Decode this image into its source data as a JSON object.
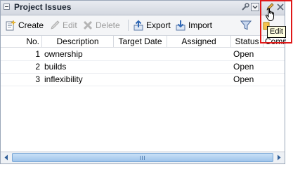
{
  "panel": {
    "title": "Project Issues"
  },
  "toolbar": {
    "create": "Create",
    "edit": "Edit",
    "delete": "Delete",
    "export": "Export",
    "import": "Import"
  },
  "table": {
    "columns": [
      "No.",
      "Description",
      "Target Date",
      "Assigned",
      "Status",
      "Comm"
    ],
    "rows": [
      {
        "no": "1",
        "description": "ownership",
        "target_date": "",
        "assigned": "",
        "status": "Open"
      },
      {
        "no": "2",
        "description": "builds",
        "target_date": "",
        "assigned": "",
        "status": "Open"
      },
      {
        "no": "3",
        "description": "inflexibility",
        "target_date": "",
        "assigned": "",
        "status": "Open"
      }
    ]
  },
  "tooltip": {
    "text": "Edit"
  },
  "icons": {
    "collapse": "collapse-icon",
    "wrench": "wrench-icon",
    "menu": "dropdown-menu-icon",
    "edit_header": "pencil-icon",
    "close": "close-icon",
    "create": "create-icon",
    "edit": "pencil-icon",
    "delete": "delete-x-icon",
    "export": "export-icon",
    "import": "import-icon",
    "filter": "filter-icon",
    "cursor": "hand-pointer-icon"
  },
  "colors": {
    "highlight": "#e01818",
    "titlebar": "#d3d8e0",
    "scroll_thumb": "#9fc4ea"
  }
}
